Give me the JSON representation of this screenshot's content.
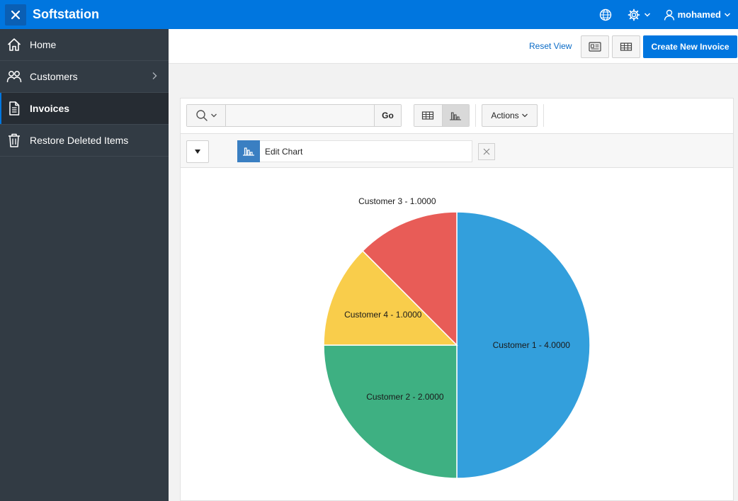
{
  "app": {
    "title": "Softstation"
  },
  "header": {
    "user": "mohamed"
  },
  "sidebar": {
    "items": [
      {
        "label": "Home",
        "icon": "home-icon"
      },
      {
        "label": "Customers",
        "icon": "users-icon"
      },
      {
        "label": "Invoices",
        "icon": "document-icon",
        "active": true
      },
      {
        "label": "Restore Deleted Items",
        "icon": "trash-icon"
      }
    ]
  },
  "toolbar": {
    "reset_label": "Reset View",
    "create_label": "Create New Invoice"
  },
  "report": {
    "search_value": "",
    "go_label": "Go",
    "actions_label": "Actions",
    "chart_chip_label": "Edit Chart"
  },
  "colors": {
    "accent": "#0076df",
    "sidebar_bg": "#323b44",
    "slice_blue": "#339fdc",
    "slice_green": "#3eb082",
    "slice_yellow": "#f9cd4b",
    "slice_red": "#e85c57"
  },
  "chart_data": {
    "type": "pie",
    "title": "",
    "slices": [
      {
        "label": "Customer 1 - 4.0000",
        "name": "Customer 1",
        "value": 4,
        "color": "#339fdc"
      },
      {
        "label": "Customer 2 - 2.0000",
        "name": "Customer 2",
        "value": 2,
        "color": "#3eb082"
      },
      {
        "label": "Customer 4 - 1.0000",
        "name": "Customer 4",
        "value": 1,
        "color": "#f9cd4b"
      },
      {
        "label": "Customer 3 - 1.0000",
        "name": "Customer 3",
        "value": 1,
        "color": "#e85c57"
      }
    ]
  }
}
